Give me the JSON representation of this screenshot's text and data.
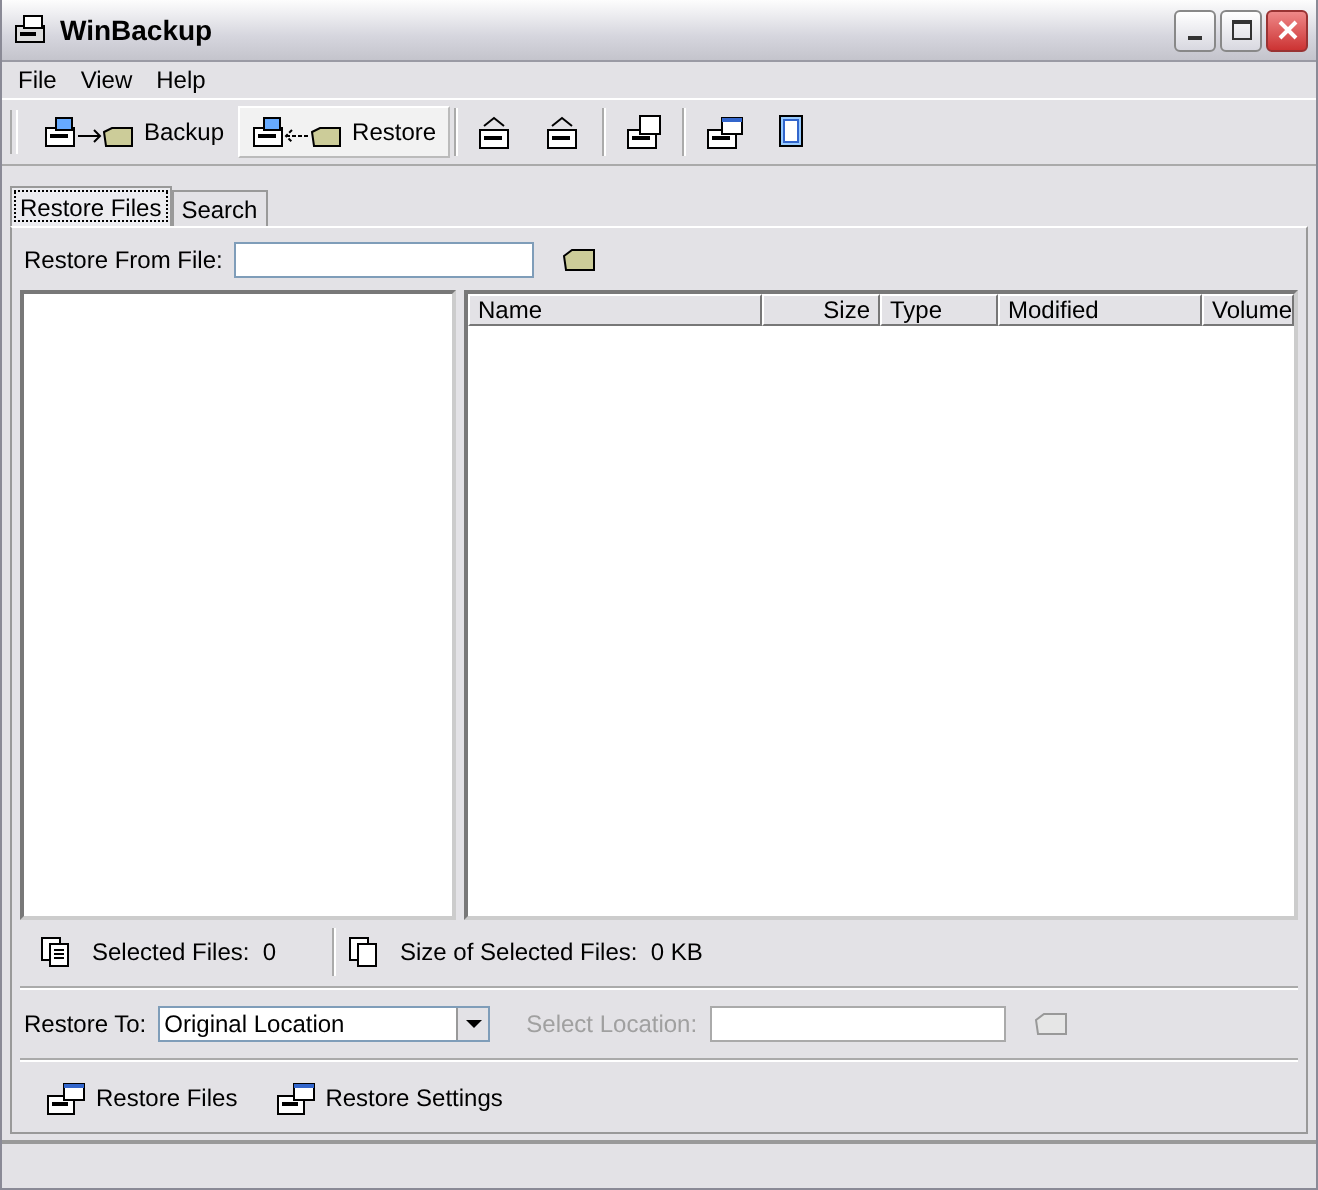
{
  "window": {
    "title": "WinBackup"
  },
  "menu": [
    "File",
    "View",
    "Help"
  ],
  "toolbar": [
    {
      "kind": "labeled",
      "label": "Backup",
      "selected": false
    },
    {
      "kind": "labeled",
      "label": "Restore",
      "selected": true
    },
    {
      "kind": "icon",
      "selected": false
    },
    {
      "kind": "icon",
      "selected": false
    },
    {
      "kind": "icon",
      "selected": false
    },
    {
      "kind": "icon",
      "selected": false
    },
    {
      "kind": "icon",
      "selected": false
    }
  ],
  "tabs": [
    {
      "label": "Restore Files",
      "selected": true
    },
    {
      "label": "Search",
      "selected": false
    }
  ],
  "restore_from_file": {
    "label": "Restore From File:"
  },
  "table": {
    "columns": [
      {
        "label": "Name"
      },
      {
        "label": "Size"
      },
      {
        "label": "Type"
      },
      {
        "label": "Modified"
      },
      {
        "label": "Volume"
      }
    ]
  },
  "summary": {
    "selected_files_label": "Selected Files:",
    "selected_files": "0",
    "size_label": "Size of Selected Files:",
    "size": "0 KB"
  },
  "restore_to": {
    "label": "Restore To:",
    "value": "Original Location"
  },
  "select_location": {
    "label": "Select Location:",
    "disabled": true
  },
  "actions": [
    "Restore Files",
    "Restore Settings"
  ]
}
